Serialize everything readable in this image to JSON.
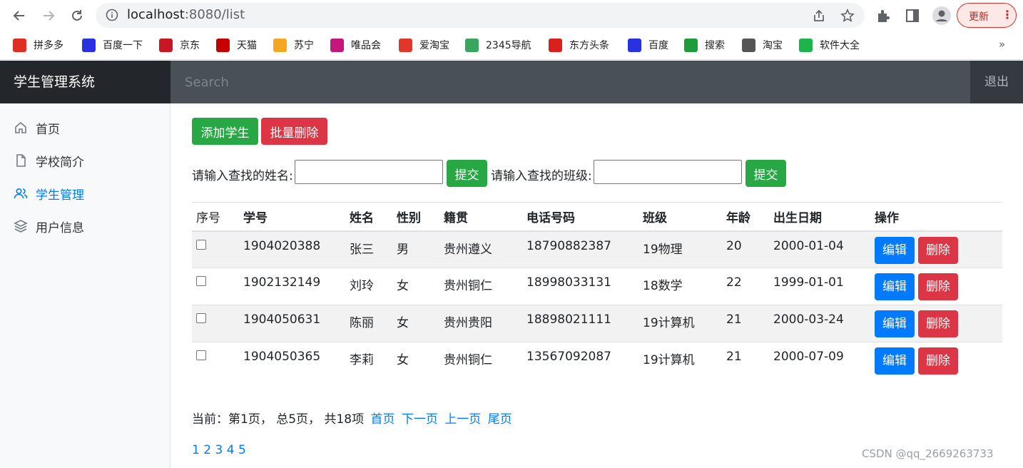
{
  "browser": {
    "url_host": "localhost",
    "url_rest": ":8080/list",
    "update_label": "更新",
    "bookmarks": [
      {
        "label": "拼多多",
        "icon": "pinduoduo-icon",
        "color": "#e02e24"
      },
      {
        "label": "百度一下",
        "icon": "baidu-paw-icon",
        "color": "#2932e1"
      },
      {
        "label": "京东",
        "icon": "jd-icon",
        "color": "#c81623"
      },
      {
        "label": "天猫",
        "icon": "tmall-icon",
        "color": "#c40000"
      },
      {
        "label": "苏宁",
        "icon": "suning-icon",
        "color": "#f5a623"
      },
      {
        "label": "唯品会",
        "icon": "vip-icon",
        "color": "#c3177b"
      },
      {
        "label": "爱淘宝",
        "icon": "aitaobao-icon",
        "color": "#e0362c"
      },
      {
        "label": "2345导航",
        "icon": "2345-icon",
        "color": "#3aa55f"
      },
      {
        "label": "东方头条",
        "icon": "dongfang-icon",
        "color": "#d8201c"
      },
      {
        "label": "百度",
        "icon": "baidu-paw-icon",
        "color": "#2932e1"
      },
      {
        "label": "搜索",
        "icon": "search-plus-icon",
        "color": "#1a9d3a"
      },
      {
        "label": "淘宝",
        "icon": "globe-icon",
        "color": "#555555"
      },
      {
        "label": "软件大全",
        "icon": "download-icon",
        "color": "#1db54b"
      }
    ],
    "bookmarks_more": "»"
  },
  "app": {
    "brand": "学生管理系统",
    "search_placeholder": "Search",
    "signout": "退出",
    "sidebar": [
      {
        "label": "首页",
        "icon": "home-icon",
        "active": false
      },
      {
        "label": "学校简介",
        "icon": "file-icon",
        "active": false
      },
      {
        "label": "学生管理",
        "icon": "users-icon",
        "active": true
      },
      {
        "label": "用户信息",
        "icon": "layers-icon",
        "active": false
      }
    ]
  },
  "toolbar": {
    "add_label": "添加学生",
    "batch_delete_label": "批量删除",
    "name_search_label": "请输入查找的姓名:",
    "class_search_label": "请输入查找的班级:",
    "submit_label": "提交"
  },
  "table": {
    "headers": [
      "序号",
      "学号",
      "姓名",
      "性别",
      "籍贯",
      "电话号码",
      "班级",
      "年龄",
      "出生日期",
      "操作"
    ],
    "edit_label": "编辑",
    "delete_label": "删除",
    "rows": [
      [
        "1904020388",
        "张三",
        "男",
        "贵州遵义",
        "18790882387",
        "19物理",
        "20",
        "2000-01-04"
      ],
      [
        "1902132149",
        "刘玲",
        "女",
        "贵州铜仁",
        "18998033131",
        "18数学",
        "22",
        "1999-01-01"
      ],
      [
        "1904050631",
        "陈丽",
        "女",
        "贵州贵阳",
        "18898021111",
        "19计算机",
        "21",
        "2000-03-24"
      ],
      [
        "1904050365",
        "李莉",
        "女",
        "贵州铜仁",
        "13567092087",
        "19计算机",
        "21",
        "2000-07-09"
      ]
    ]
  },
  "pager": {
    "summary": "当前：第1页， 总5页， 共18项",
    "first": "首页",
    "next": "下一页",
    "prev": "上一页",
    "last": "尾页",
    "pages": [
      "1",
      "2",
      "3",
      "4",
      "5"
    ]
  },
  "watermark": "CSDN @qq_2669263733",
  "colors": {
    "success": "#28a745",
    "danger": "#dc3545",
    "primary": "#007bff",
    "navbar": "#343a40"
  }
}
